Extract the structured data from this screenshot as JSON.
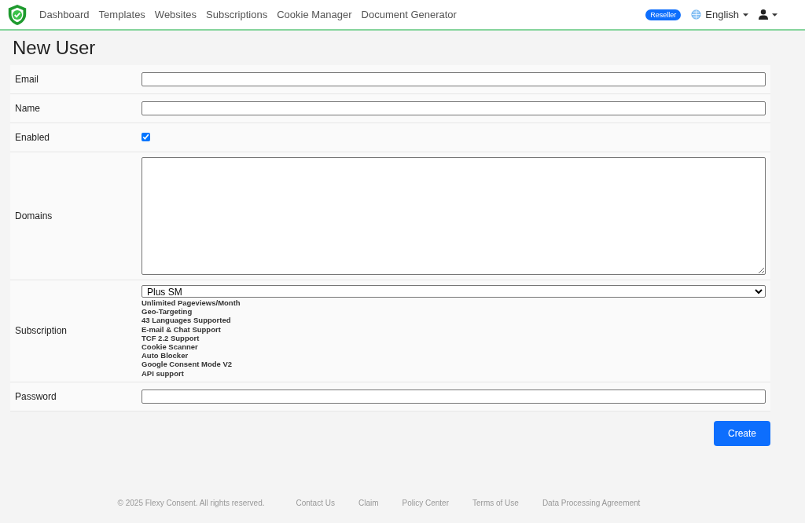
{
  "nav": {
    "links": [
      "Dashboard",
      "Templates",
      "Websites",
      "Subscriptions",
      "Cookie Manager",
      "Document Generator"
    ],
    "badge": "Reseller",
    "language": "English"
  },
  "title": "New User",
  "fields": [
    {
      "kind": "text",
      "label": "Email"
    },
    {
      "kind": "text",
      "label": "Name"
    },
    {
      "kind": "checkbox",
      "label": "Enabled",
      "checked": true
    },
    {
      "kind": "textarea",
      "label": "Domains"
    },
    {
      "kind": "select",
      "label": "Subscription",
      "value": "Plus SM",
      "features": [
        "Unlimited Pageviews/Month",
        "Geo-Targeting",
        "43 Languages Supported",
        "E-mail & Chat Support",
        "TCF 2.2 Support",
        "Cookie Scanner",
        "Auto Blocker",
        "Google Consent Mode V2",
        "API support"
      ]
    },
    {
      "kind": "password",
      "label": "Password"
    }
  ],
  "submit": "Create",
  "footer": {
    "copyright": "© 2025 Flexy Consent. All rights reserved.",
    "links": [
      "Contact Us",
      "Claim",
      "Policy Center",
      "Terms of Use",
      "Data Processing Agreement"
    ]
  }
}
